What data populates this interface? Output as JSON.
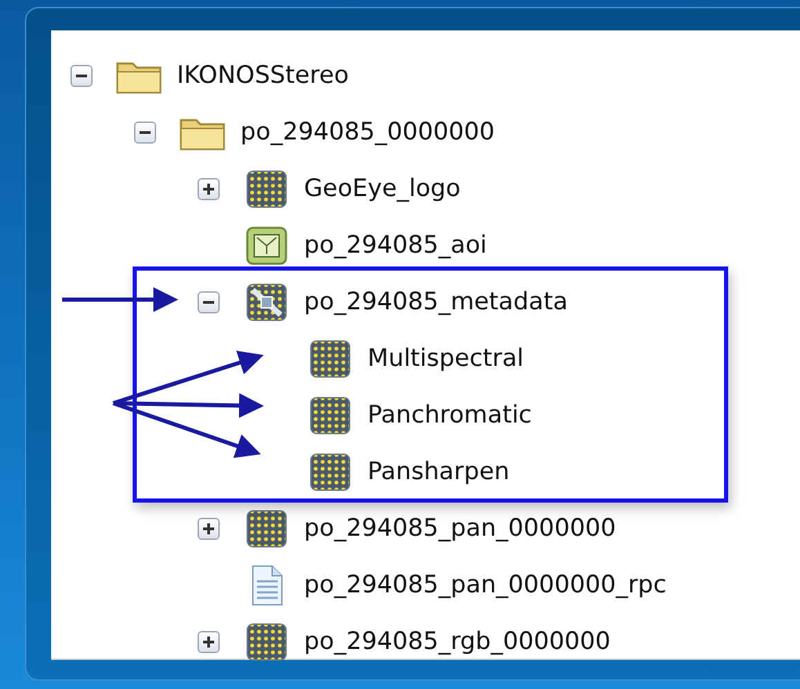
{
  "tree": [
    {
      "label": "IKONOSStereo",
      "kind": "folder",
      "expanded": true,
      "children": [
        {
          "label": "po_294085_0000000",
          "kind": "folder",
          "expanded": true,
          "children": [
            {
              "label": "GeoEye_logo",
              "kind": "raster",
              "expanded": false
            },
            {
              "label": "po_294085_aoi",
              "kind": "aoi"
            },
            {
              "label": "po_294085_metadata",
              "kind": "metadata",
              "expanded": true,
              "children": [
                {
                  "label": "Multispectral",
                  "kind": "raster"
                },
                {
                  "label": "Panchromatic",
                  "kind": "raster"
                },
                {
                  "label": "Pansharpen",
                  "kind": "raster"
                }
              ]
            },
            {
              "label": "po_294085_pan_0000000",
              "kind": "raster",
              "expanded": false
            },
            {
              "label": "po_294085_pan_0000000_rpc",
              "kind": "document"
            },
            {
              "label": "po_294085_rgb_0000000",
              "kind": "raster",
              "expanded": false
            }
          ]
        }
      ]
    }
  ]
}
